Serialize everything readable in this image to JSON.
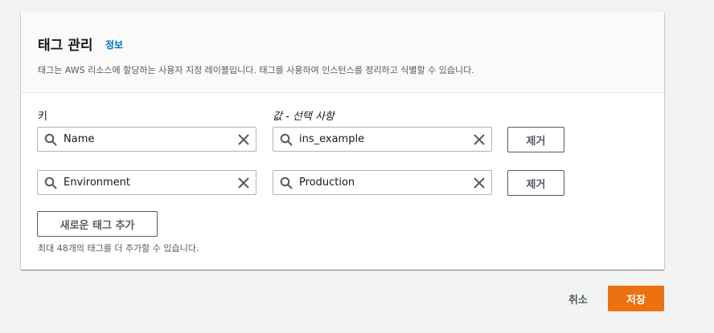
{
  "header": {
    "title": "태그 관리",
    "info_link": "정보",
    "description": "태그는 AWS 리소스에 할당하는 사용자 지정 레이블입니다. 태그를 사용하여 인스턴스를 정리하고 식별할 수 있습니다."
  },
  "columns": {
    "key_label": "키",
    "value_label": "값 - 선택 사항"
  },
  "tags": [
    {
      "key": "Name",
      "value": "ins_example",
      "remove_label": "제거"
    },
    {
      "key": "Environment",
      "value": "Production",
      "remove_label": "제거"
    }
  ],
  "add_tag_label": "새로운 태그 추가",
  "limit_note": "최대 48개의 태그를 더 추가할 수 있습니다.",
  "footer": {
    "cancel_label": "취소",
    "save_label": "저장"
  },
  "colors": {
    "accent": "#ec7211",
    "link": "#0073bb",
    "border": "#aab7b8"
  },
  "icons": {
    "field_left": "search-icon",
    "field_right": "close-icon"
  }
}
